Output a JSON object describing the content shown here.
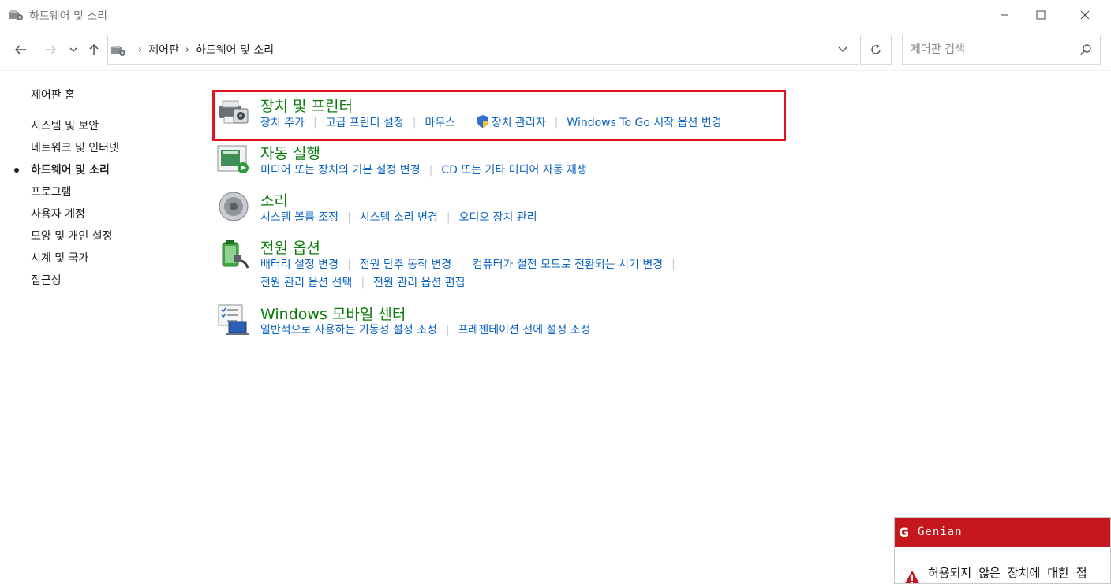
{
  "window": {
    "title": "하드웨어 및 소리"
  },
  "address": {
    "crumbs": [
      "제어판",
      "하드웨어 및 소리"
    ],
    "search_placeholder": "제어판 검색"
  },
  "sidebar": {
    "home": "제어판 홈",
    "items": [
      {
        "label": "시스템 및 보안",
        "active": false
      },
      {
        "label": "네트워크 및 인터넷",
        "active": false
      },
      {
        "label": "하드웨어 및 소리",
        "active": true
      },
      {
        "label": "프로그램",
        "active": false
      },
      {
        "label": "사용자 계정",
        "active": false
      },
      {
        "label": "모양 및 개인 설정",
        "active": false
      },
      {
        "label": "시계 및 국가",
        "active": false
      },
      {
        "label": "접근성",
        "active": false
      }
    ]
  },
  "categories": {
    "devices": {
      "title": "장치 및 프린터",
      "links": [
        "장치 추가",
        "고급 프린터 설정",
        "마우스",
        "장치 관리자",
        "Windows To Go 시작 옵션 변경"
      ]
    },
    "autoplay": {
      "title": "자동 실행",
      "links": [
        "미디어 또는 장치의 기본 설정 변경",
        "CD 또는 기타 미디어 자동 재생"
      ]
    },
    "sound": {
      "title": "소리",
      "links": [
        "시스템 볼륨 조정",
        "시스템 소리 변경",
        "오디오 장치 관리"
      ]
    },
    "power": {
      "title": "전원 옵션",
      "links": [
        "배터리 설정 변경",
        "전원 단추 동작 변경",
        "컴퓨터가 절전 모드로 전환되는 시기 변경",
        "전원 관리 옵션 선택",
        "전원 관리 옵션 편집"
      ]
    },
    "mobility": {
      "title": "Windows 모바일 센터",
      "links": [
        "일반적으로 사용하는 기동성 설정 조정",
        "프레젠테이션 전에 설정 조정"
      ]
    }
  },
  "genian": {
    "logo": "G",
    "brand": "Genian",
    "message": "허용되지 않은 장치에 대한 접"
  },
  "colors": {
    "category_title": "#0a7a0a",
    "link": "#0b63c2",
    "highlight": "#e0141e",
    "genian_red": "#c4161c"
  }
}
